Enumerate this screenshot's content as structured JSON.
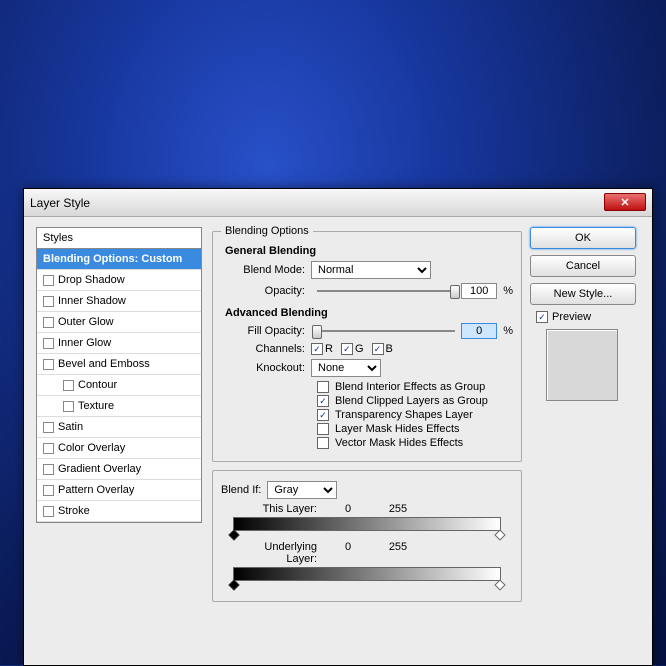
{
  "title": "Layer Style",
  "sidebar": {
    "header": "Styles",
    "selected": "Blending Options: Custom",
    "items": [
      "Drop Shadow",
      "Inner Shadow",
      "Outer Glow",
      "Inner Glow",
      "Bevel and Emboss",
      "Contour",
      "Texture",
      "Satin",
      "Color Overlay",
      "Gradient Overlay",
      "Pattern Overlay",
      "Stroke"
    ]
  },
  "blending": {
    "title": "Blending Options",
    "general": {
      "title": "General Blending",
      "blend_mode_label": "Blend Mode:",
      "blend_mode": "Normal",
      "opacity_label": "Opacity:",
      "opacity": "100",
      "pct": "%"
    },
    "advanced": {
      "title": "Advanced Blending",
      "fill_opacity_label": "Fill Opacity:",
      "fill_opacity": "0",
      "channels_label": "Channels:",
      "channels": {
        "R": "R",
        "G": "G",
        "B": "B"
      },
      "knockout_label": "Knockout:",
      "knockout": "None",
      "opts": {
        "blend_interior": "Blend Interior Effects as Group",
        "blend_clipped": "Blend Clipped Layers as Group",
        "transparency": "Transparency Shapes Layer",
        "layer_mask": "Layer Mask Hides Effects",
        "vector_mask": "Vector Mask Hides Effects"
      }
    },
    "blendif": {
      "label": "Blend If:",
      "mode": "Gray",
      "this_layer": "This Layer:",
      "underlying": "Underlying Layer:",
      "v0": "0",
      "v1": "255"
    }
  },
  "right": {
    "ok": "OK",
    "cancel": "Cancel",
    "new_style": "New Style...",
    "preview": "Preview"
  }
}
